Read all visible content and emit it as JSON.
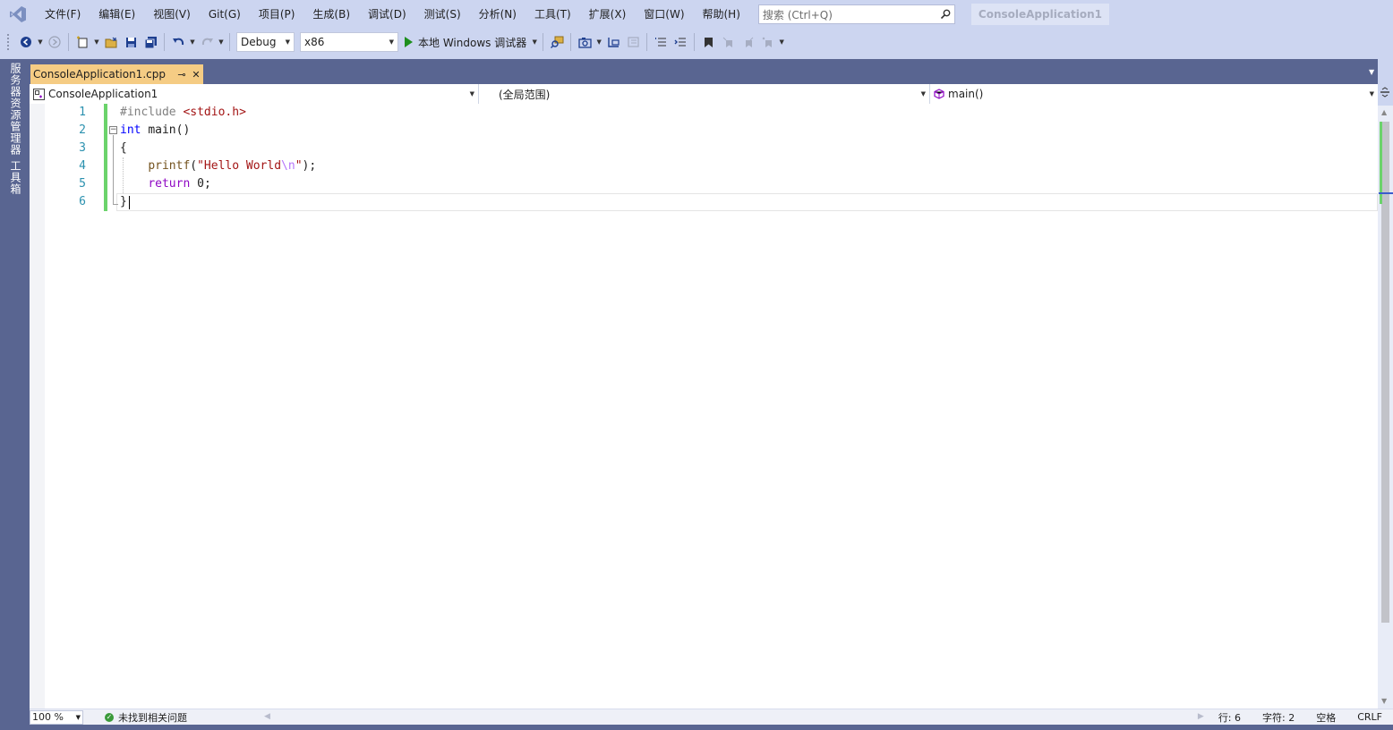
{
  "menu": {
    "items": [
      "文件(F)",
      "编辑(E)",
      "视图(V)",
      "Git(G)",
      "项目(P)",
      "生成(B)",
      "调试(D)",
      "测试(S)",
      "分析(N)",
      "工具(T)",
      "扩展(X)",
      "窗口(W)",
      "帮助(H)"
    ],
    "search_placeholder": "搜索 (Ctrl+Q)",
    "solution_title": "ConsoleApplication1"
  },
  "toolbar": {
    "config": "Debug",
    "platform": "x86",
    "run_label": "本地 Windows 调试器"
  },
  "side_rail": {
    "tabs": [
      "服务器资源管理器",
      "工具箱"
    ]
  },
  "document_tab": {
    "filename": "ConsoleApplication1.cpp",
    "pin_glyph": "⊸",
    "close_glyph": "✕"
  },
  "navigation_bar": {
    "project": "ConsoleApplication1",
    "scope": "(全局范围)",
    "member": "main()"
  },
  "editor": {
    "line_numbers": [
      "1",
      "2",
      "3",
      "4",
      "5",
      "6"
    ],
    "code": {
      "line1": {
        "directive": "#include",
        "header": "<stdio.h>"
      },
      "line2": {
        "type": "int",
        "name": "main()"
      },
      "line3": {
        "brace": "{"
      },
      "line4": {
        "indent": "    ",
        "fn": "printf",
        "open": "(",
        "str_a": "\"Hello World",
        "esc": "\\n",
        "str_b": "\"",
        "close": ");"
      },
      "line5": {
        "indent": "    ",
        "kw": "return",
        "space": " ",
        "num": "0",
        "semi": ";"
      },
      "line6": {
        "brace": "}"
      }
    }
  },
  "status": {
    "zoom": "100 %",
    "issues": "未找到相关问题",
    "line": "行: 6",
    "char": "字符: 2",
    "whitespace": "空格",
    "line_ending": "CRLF"
  },
  "colors": {
    "accent_tab": "#f5cc84",
    "chrome": "#ccd5f0",
    "rail": "#596591",
    "change_bar": "#6bd36b"
  }
}
